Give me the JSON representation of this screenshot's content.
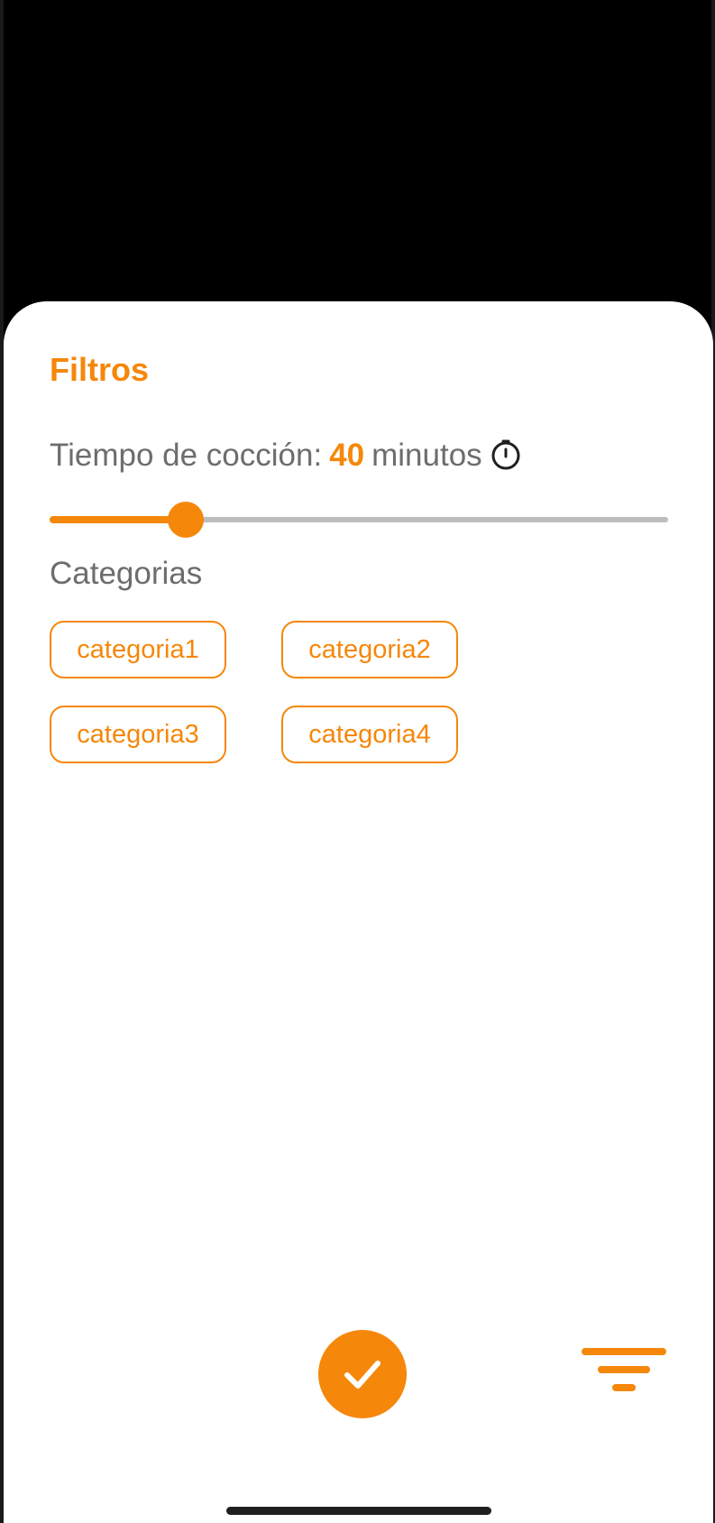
{
  "sheet": {
    "title": "Filtros",
    "cooking_time": {
      "label": "Tiempo de cocción:",
      "value": "40",
      "unit": "minutos",
      "icon": "timer-icon",
      "slider_fraction": 0.22
    },
    "categories": {
      "label": "Categorias",
      "items": [
        "categoria1",
        "categoria2",
        "categoria3",
        "categoria4"
      ]
    }
  },
  "actions": {
    "confirm_icon": "check-icon",
    "filter_icon": "filter-icon"
  },
  "colors": {
    "accent": "#f5870a",
    "text_muted": "#6d6d6d",
    "track": "#bdbdbd",
    "backdrop": "#000000",
    "sheet": "#ffffff"
  }
}
